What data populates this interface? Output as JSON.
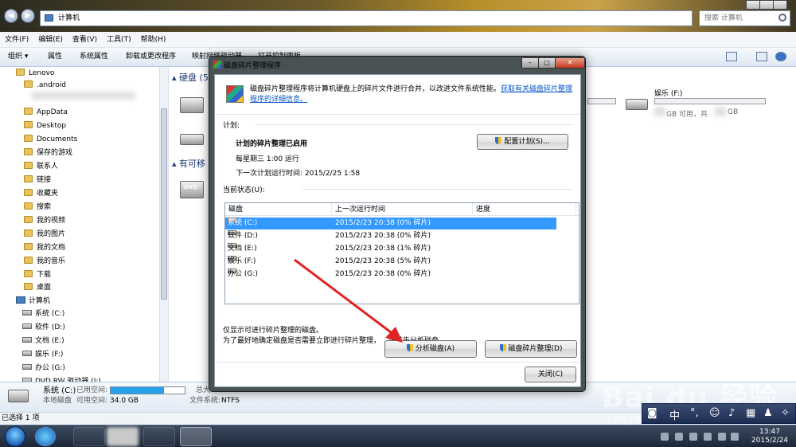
{
  "explorer": {
    "address": "计算机",
    "search_placeholder": "搜索 计算机",
    "menu": [
      "文件(F)",
      "编辑(E)",
      "查看(V)",
      "工具(T)",
      "帮助(H)"
    ],
    "toolbar": {
      "organize": "组织 ▾",
      "properties": "属性",
      "system_properties": "系统属性",
      "uninstall": "卸载或更改程序",
      "map_drive": "映射网络驱动器",
      "control_panel": "打开控制面板"
    },
    "sidebar": {
      "user": "Lenovo",
      "folders": [
        ".android",
        "AppData",
        "Desktop",
        "Documents",
        "保存的游戏",
        "联系人",
        "链接",
        "收藏夹",
        "搜索",
        "我的视频",
        "我的图片",
        "我的文档",
        "我的音乐",
        "下载",
        "桌面"
      ],
      "computer": "计算机",
      "drives": [
        "系统 (C:)",
        "软件 (D:)",
        "文档 (E:)",
        "娱乐 (F:)",
        "办公 (G:)",
        "DVD RW 驱动器 (I:)"
      ]
    },
    "content": {
      "hard_disk_header": "硬盘 (5",
      "removable_header": "有可移",
      "dvd_label": "DVD",
      "drive_f_label": "娱乐 (F:)",
      "drive_f_space_a": "GB 可用，共",
      "drive_f_space_b": "GB"
    },
    "details": {
      "name": "系统 (C:)",
      "used_label": "已用空间:",
      "type": "本地磁盘",
      "free_label": "可用空间:",
      "free_value": "34.0 GB",
      "total_label": "总大",
      "fs_label": "文件系统:",
      "fs_value": "NTFS",
      "used_fraction": 0.72
    },
    "status": "已选择 1 项"
  },
  "dialog": {
    "title": "磁盘碎片整理程序",
    "desc": "磁盘碎片整理程序将计算机硬盘上的碎片文件进行合并，以改进文件系统性能。",
    "desc_link": "获取有关磁盘碎片整理程序的详细信息。",
    "schedule_label": "计划:",
    "schedule_on": "计划的碎片整理已启用",
    "schedule_when": "每星期三 1:00 运行",
    "next_run": "下一次计划运行时间: 2015/2/25 1:58",
    "config_button": "配置计划(S)...",
    "status_label": "当前状态(U):",
    "columns": [
      "磁盘",
      "上一次运行时间",
      "进度"
    ],
    "disks": [
      {
        "name": "系统 (C:)",
        "last": "2015/2/23 20:38 (0% 碎片)",
        "progress": ""
      },
      {
        "name": "软件 (D:)",
        "last": "2015/2/23 20:38 (0% 碎片)",
        "progress": ""
      },
      {
        "name": "文档 (E:)",
        "last": "2015/2/23 20:38 (1% 碎片)",
        "progress": ""
      },
      {
        "name": "娱乐 (F:)",
        "last": "2015/2/23 20:38 (5% 碎片)",
        "progress": ""
      },
      {
        "name": "办公 (G:)",
        "last": "2015/2/23 20:38 (0% 碎片)",
        "progress": ""
      }
    ],
    "note1": "仅显示可进行碎片整理的磁盘。",
    "note2": "为了最好地确定磁盘是否需要立即进行碎片整理，",
    "note2b": "请首先分析磁盘。",
    "analyze_button": "分析磁盘(A)",
    "defrag_button": "磁盘碎片整理(D)",
    "close_button": "关闭(C)"
  },
  "watermark": {
    "logo": "Bai du 经验",
    "url": "jingyan.baidu.com"
  },
  "ime": {
    "a": "中",
    "b": "°,",
    "c": "☺"
  },
  "taskbar": {
    "time": "13:47",
    "date": "2015/2/24"
  },
  "colors": {
    "selection": "#3399ff",
    "link": "#0a55c8",
    "arrow": "#e02424",
    "capacity": "#27a0e8"
  }
}
